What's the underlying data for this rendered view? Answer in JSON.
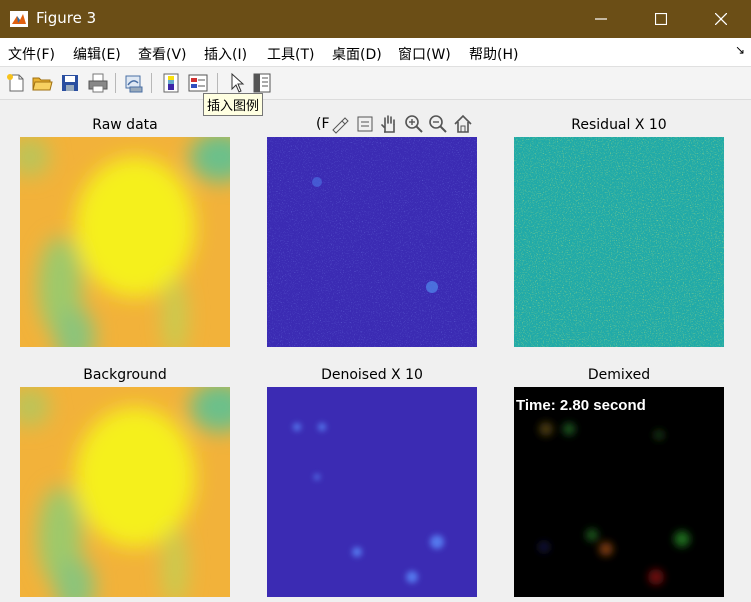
{
  "window": {
    "title": "Figure 3"
  },
  "menu": [
    "文件(F)",
    "编辑(E)",
    "查看(V)",
    "插入(I)",
    "工具(T)",
    "桌面(D)",
    "窗口(W)",
    "帮助(H)"
  ],
  "tooltip": "插入图例",
  "axes_toolbar": {
    "truncated_title": "(F"
  },
  "panels": {
    "raw": {
      "title": "Raw data"
    },
    "residual": {
      "title": "Residual X 10"
    },
    "background": {
      "title": "Background"
    },
    "denoised": {
      "title": "Denoised X 10"
    },
    "demixed": {
      "title": "Demixed",
      "overlay": "Time: 2.80 second"
    }
  },
  "icons": {
    "toolbar": [
      "new-figure-icon",
      "open-icon",
      "save-icon",
      "print-icon",
      "link-plot-icon",
      "colorbar-icon",
      "legend-icon",
      "pointer-icon",
      "property-editor-icon"
    ],
    "axes_toolbar": [
      "brush-icon",
      "data-tips-icon",
      "pan-icon",
      "zoom-in-icon",
      "zoom-out-icon",
      "home-icon"
    ]
  },
  "colors": {
    "titlebar": "#6b4e16",
    "background": "#f0f0f0",
    "parula_low": "#3d26a8",
    "parula_mid": "#20b2aa",
    "parula_high": "#f9fb0e"
  }
}
